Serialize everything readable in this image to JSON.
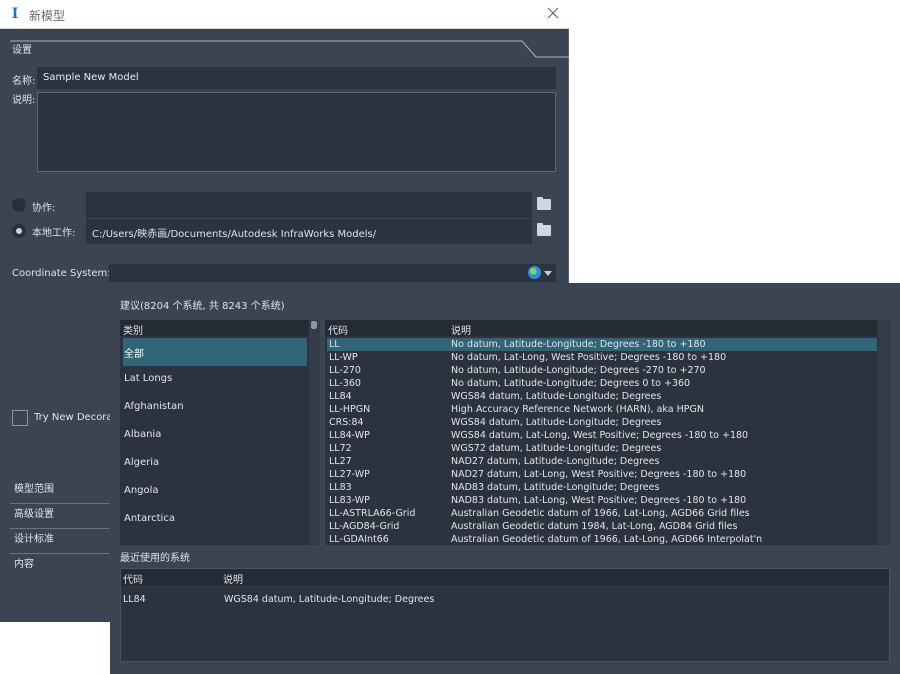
{
  "window": {
    "title": "新模型",
    "app_icon": "infraworks-icon",
    "close_icon": "close-icon"
  },
  "settings_tab": "设置",
  "form": {
    "name_label": "名称:",
    "name_value": "Sample New Model",
    "desc_label": "说明:",
    "collab_label": "协作:",
    "local_label": "本地工作:",
    "local_path": "C:/Users/映赤画/Documents/Autodesk InfraWorks Models/",
    "coord_label": "Coordinate System:",
    "try_label": "Try New Decora"
  },
  "sidebar": {
    "items": [
      {
        "label": "模型范围"
      },
      {
        "label": "高级设置"
      },
      {
        "label": "设计标准"
      },
      {
        "label": "内容"
      }
    ]
  },
  "popup": {
    "suggest_title": "建议(8204 个系统, 共 8243 个系统)",
    "cat_header": "类别",
    "categories": [
      {
        "label": "全部",
        "selected": true
      },
      {
        "label": "Lat Longs"
      },
      {
        "label": "Afghanistan"
      },
      {
        "label": "Albania"
      },
      {
        "label": "Algeria"
      },
      {
        "label": "Angola"
      },
      {
        "label": "Antarctica"
      }
    ],
    "code_header": "代码",
    "desc_header": "说明",
    "rows": [
      {
        "code": "LL",
        "desc": "No datum, Latitude-Longitude; Degrees -180 to +180",
        "selected": true
      },
      {
        "code": "LL-WP",
        "desc": "No datum, Lat-Long, West Positive; Degrees -180 to +180"
      },
      {
        "code": "LL-270",
        "desc": "No datum, Latitude-Longitude; Degrees -270 to +270"
      },
      {
        "code": "LL-360",
        "desc": "No datum, Latitude-Longitude; Degrees 0 to +360"
      },
      {
        "code": "LL84",
        "desc": "WGS84 datum, Latitude-Longitude; Degrees"
      },
      {
        "code": "LL-HPGN",
        "desc": "High Accuracy Reference Network (HARN), aka HPGN"
      },
      {
        "code": "CRS:84",
        "desc": "WGS84 datum, Latitude-Longitude; Degrees"
      },
      {
        "code": "LL84-WP",
        "desc": "WGS84 datum, Lat-Long, West Positive; Degrees -180 to +180"
      },
      {
        "code": "LL72",
        "desc": "WGS72 datum, Latitude-Longitude; Degrees"
      },
      {
        "code": "LL27",
        "desc": "NAD27 datum, Latitude-Longitude; Degrees"
      },
      {
        "code": "LL27-WP",
        "desc": "NAD27 datum, Lat-Long, West Positive; Degrees -180 to +180"
      },
      {
        "code": "LL83",
        "desc": "NAD83 datum, Latitude-Longitude; Degrees"
      },
      {
        "code": "LL83-WP",
        "desc": "NAD83 datum, Lat-Long, West Positive; Degrees -180 to +180"
      },
      {
        "code": "LL-ASTRLA66-Grid",
        "desc": "Australian Geodetic datum of 1966, Lat-Long, AGD66 Grid files"
      },
      {
        "code": "LL-AGD84-Grid",
        "desc": "Australian Geodetic datum 1984, Lat-Long, AGD84 Grid files"
      },
      {
        "code": "LL-GDAInt66",
        "desc": "Australian Geodetic datum of 1966, Lat-Long, AGD66 Interpolat'n"
      }
    ],
    "recent_title": "最近使用的系统",
    "recent_code_header": "代码",
    "recent_desc_header": "说明",
    "recent_rows": [
      {
        "code": "LL84",
        "desc": "WGS84 datum, Latitude-Longitude; Degrees"
      }
    ]
  }
}
